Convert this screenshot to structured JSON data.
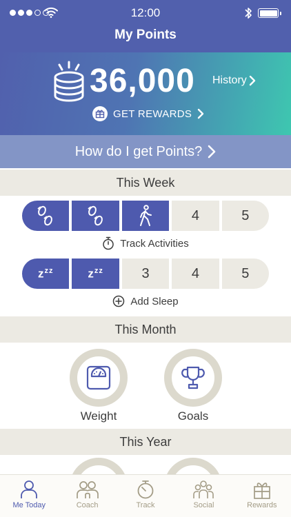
{
  "status": {
    "time": "12:00"
  },
  "header": {
    "title": "My Points"
  },
  "banner": {
    "points": "36,000",
    "history_label": "History",
    "rewards_label": "GET REWARDS"
  },
  "how_label": "How do I get Points?",
  "week": {
    "title": "This Week",
    "activities": {
      "segments": [
        {
          "label": "",
          "filled": true,
          "icon": "footprints-icon"
        },
        {
          "label": "",
          "filled": true,
          "icon": "footprints-icon"
        },
        {
          "label": "",
          "filled": true,
          "icon": "walking-person-icon"
        },
        {
          "label": "4",
          "filled": false
        },
        {
          "label": "5",
          "filled": false
        }
      ],
      "action_label": "Track Activities"
    },
    "sleep": {
      "segments": [
        {
          "label": "zzz",
          "filled": true,
          "icon": "sleep-zzz-icon"
        },
        {
          "label": "zzz",
          "filled": true,
          "icon": "sleep-zzz-icon"
        },
        {
          "label": "3",
          "filled": false
        },
        {
          "label": "4",
          "filled": false
        },
        {
          "label": "5",
          "filled": false
        }
      ],
      "action_label": "Add Sleep"
    }
  },
  "month": {
    "title": "This Month",
    "items": [
      {
        "label": "Weight",
        "icon": "scale-icon"
      },
      {
        "label": "Goals",
        "icon": "trophy-icon"
      }
    ]
  },
  "year": {
    "title": "This Year"
  },
  "tabs": [
    {
      "label": "Me Today",
      "icon": "person-icon",
      "active": true
    },
    {
      "label": "Coach",
      "icon": "coach-icon",
      "active": false
    },
    {
      "label": "Track",
      "icon": "stopwatch-icon",
      "active": false
    },
    {
      "label": "Social",
      "icon": "social-icon",
      "active": false
    },
    {
      "label": "Rewards",
      "icon": "gift-icon",
      "active": false
    }
  ],
  "colors": {
    "primary": "#4e5aae",
    "header": "#5160ad",
    "section_bg": "#eceae3",
    "ring": "#dcd9cd",
    "tab_inactive": "#a39c86"
  }
}
